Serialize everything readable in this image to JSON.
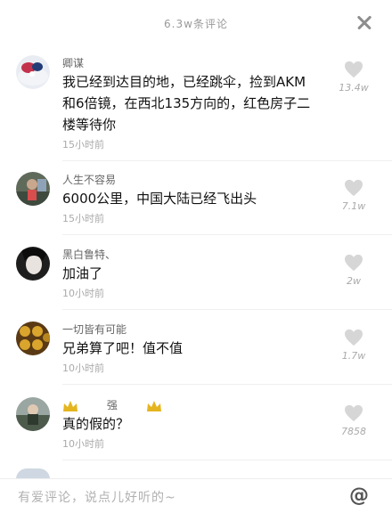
{
  "header": {
    "title": "6.3w条评论"
  },
  "comments": [
    {
      "user": "卿谋",
      "text": "我已经到达目的地，已经跳伞，捡到AKM和6倍镜，在西北135方向的，红色房子二楼等待你",
      "time": "15小时前",
      "likes": "13.4w"
    },
    {
      "user": "人生不容易",
      "text": "6000公里，中国大陆已经飞出头",
      "time": "15小时前",
      "likes": "7.1w"
    },
    {
      "user": "黑白鲁特、",
      "text": "加油了",
      "time": "10小时前",
      "likes": "2w"
    },
    {
      "user": "一切皆有可能",
      "text": "兄弟算了吧！值不值",
      "time": "10小时前",
      "likes": "1.7w"
    },
    {
      "user": "强",
      "text": "真的假的？",
      "time": "10小时前",
      "likes": "7858"
    }
  ],
  "footer": {
    "input_placeholder": "有爱评论，说点儿好听的~",
    "at_label": "@"
  },
  "icons": {
    "close": "close-icon",
    "like": "heart-icon",
    "crown": "crown-icon"
  }
}
